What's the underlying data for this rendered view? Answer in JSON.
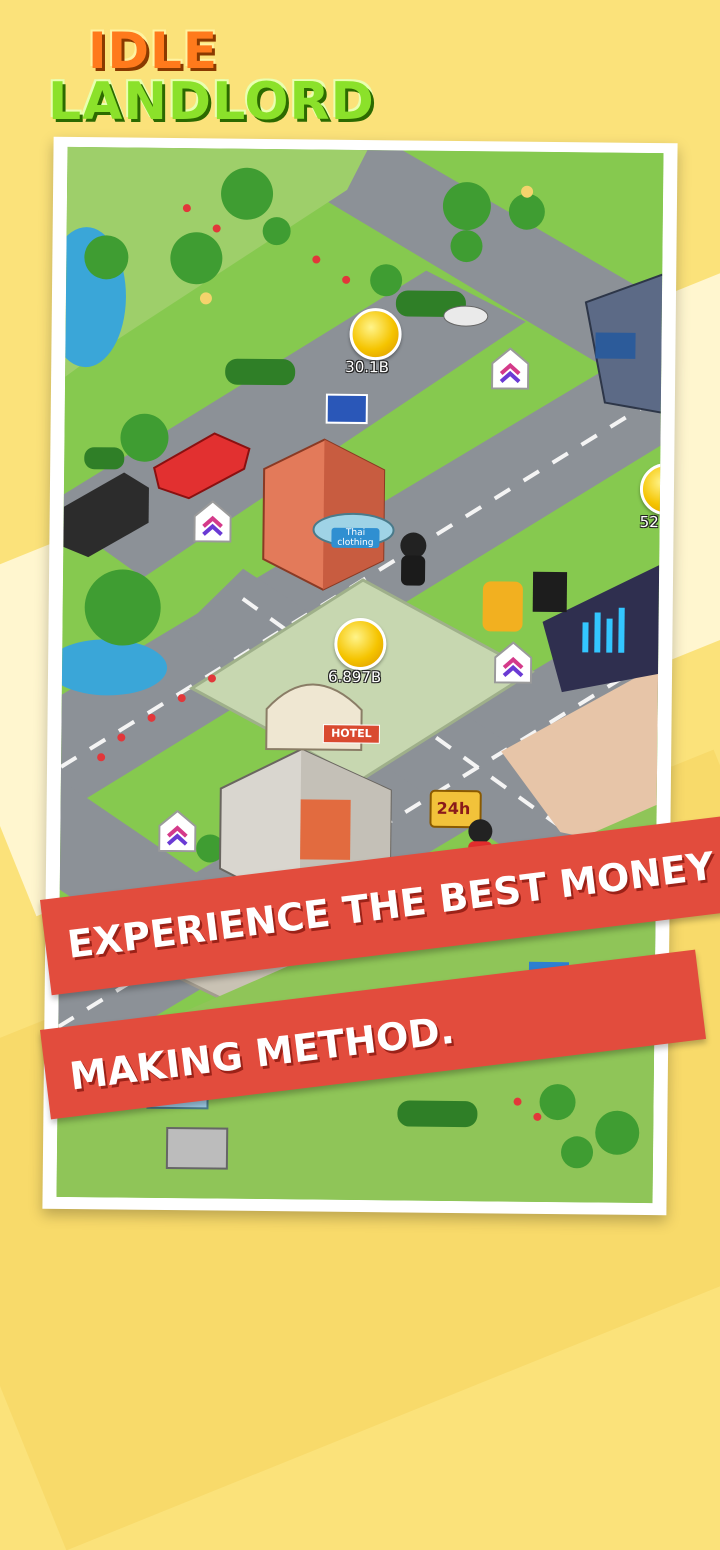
{
  "logo": {
    "line1": "IDLE",
    "line2": "LANDLORD"
  },
  "coins": [
    {
      "label": "30.1B"
    },
    {
      "label": "52"
    },
    {
      "label": "6.897B"
    }
  ],
  "buildings": {
    "shop_sign": "Thai clothing",
    "hotel_sign": "HOTEL",
    "store_sign": "24h"
  },
  "banner": {
    "line1": "EXPERIENCE THE BEST MONEY",
    "line2": "MAKING METHOD."
  },
  "colors": {
    "background": "#fbe27a",
    "banner": "#e24c3d",
    "grass": "#7fc24a",
    "road": "#8a8f95"
  }
}
